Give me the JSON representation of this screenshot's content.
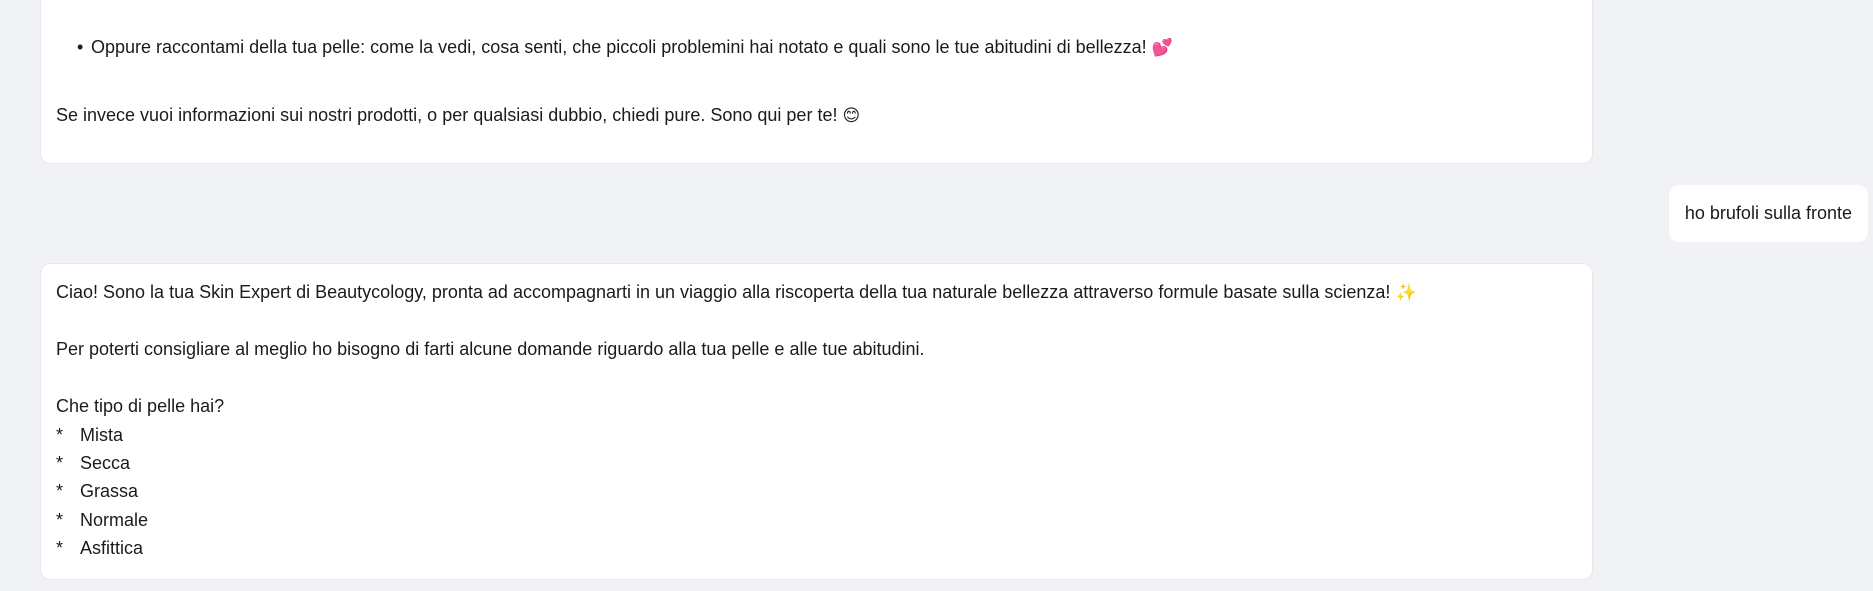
{
  "messages": [
    {
      "role": "assistant",
      "bullet": "Oppure raccontami della tua pelle: come la vedi, cosa senti, che piccoli problemini hai notato e quali sono le tue abitudini di bellezza!",
      "bullet_emoji": "💕",
      "closing": "Se invece vuoi informazioni sui nostri prodotti, o per qualsiasi dubbio, chiedi pure. Sono qui per te!",
      "closing_emoji": "😊"
    },
    {
      "role": "user",
      "text": "ho brufoli sulla fronte"
    },
    {
      "role": "assistant",
      "intro": "Ciao! Sono la tua Skin Expert di Beautycology, pronta ad accompagnarti in un viaggio alla riscoperta della tua naturale bellezza attraverso formule basate sulla scienza!",
      "intro_emoji": "✨",
      "ask": "Per poterti consigliare al meglio ho bisogno di farti alcune domande riguardo alla tua pelle e alle tue abitudini.",
      "question": "Che tipo di pelle hai?",
      "list_marker": "*",
      "options": [
        "Mista",
        "Secca",
        "Grassa",
        "Normale",
        "Asfittica"
      ]
    }
  ],
  "colors": {
    "background": "#f1f2f5",
    "bubble": "#ffffff",
    "bubble_border": "#e6e7ea",
    "text": "#1b1b1f"
  }
}
